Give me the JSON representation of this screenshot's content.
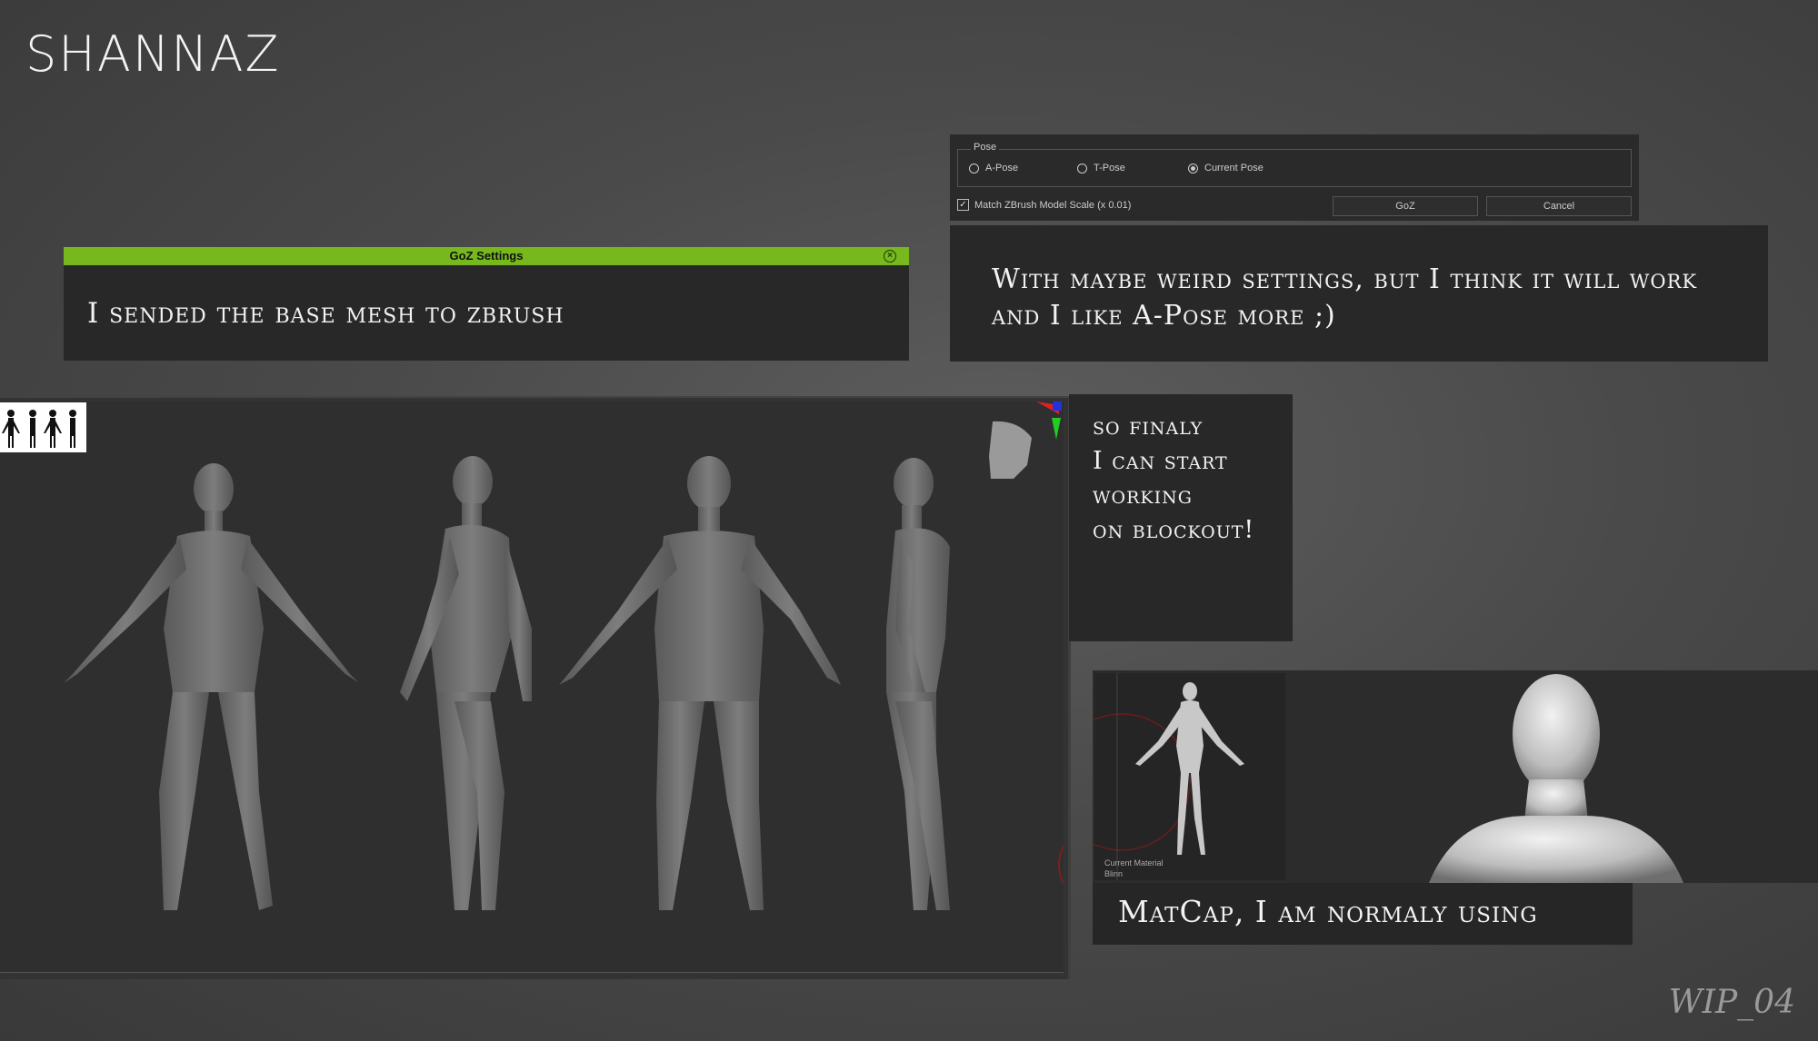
{
  "brand": "SHANNAZ",
  "watermark": "WIP_04",
  "goz": {
    "title": "GoZ Settings",
    "note": "I sended the base mesh to zbrush"
  },
  "pose_dialog": {
    "group_label": "Pose",
    "options": [
      "A-Pose",
      "T-Pose",
      "Current Pose"
    ],
    "selected": "Current Pose",
    "match_scale": "Match ZBrush Model Scale (x 0.01)",
    "goz_button": "GoZ",
    "cancel_button": "Cancel"
  },
  "pose_note": {
    "line1": "With maybe weird settings, but I think it will work",
    "line2": "and I like A-Pose more ;)"
  },
  "blockout_note": [
    "so finaly",
    "I can start",
    "working",
    "on blockout!"
  ],
  "matcap": {
    "label_line1": "Current Material",
    "label_line2": "Blinn",
    "note": "MatCap, I am normaly using"
  },
  "colors": {
    "accent": "#76b81e",
    "panel": "#282828",
    "background": "#4a4a4a"
  }
}
